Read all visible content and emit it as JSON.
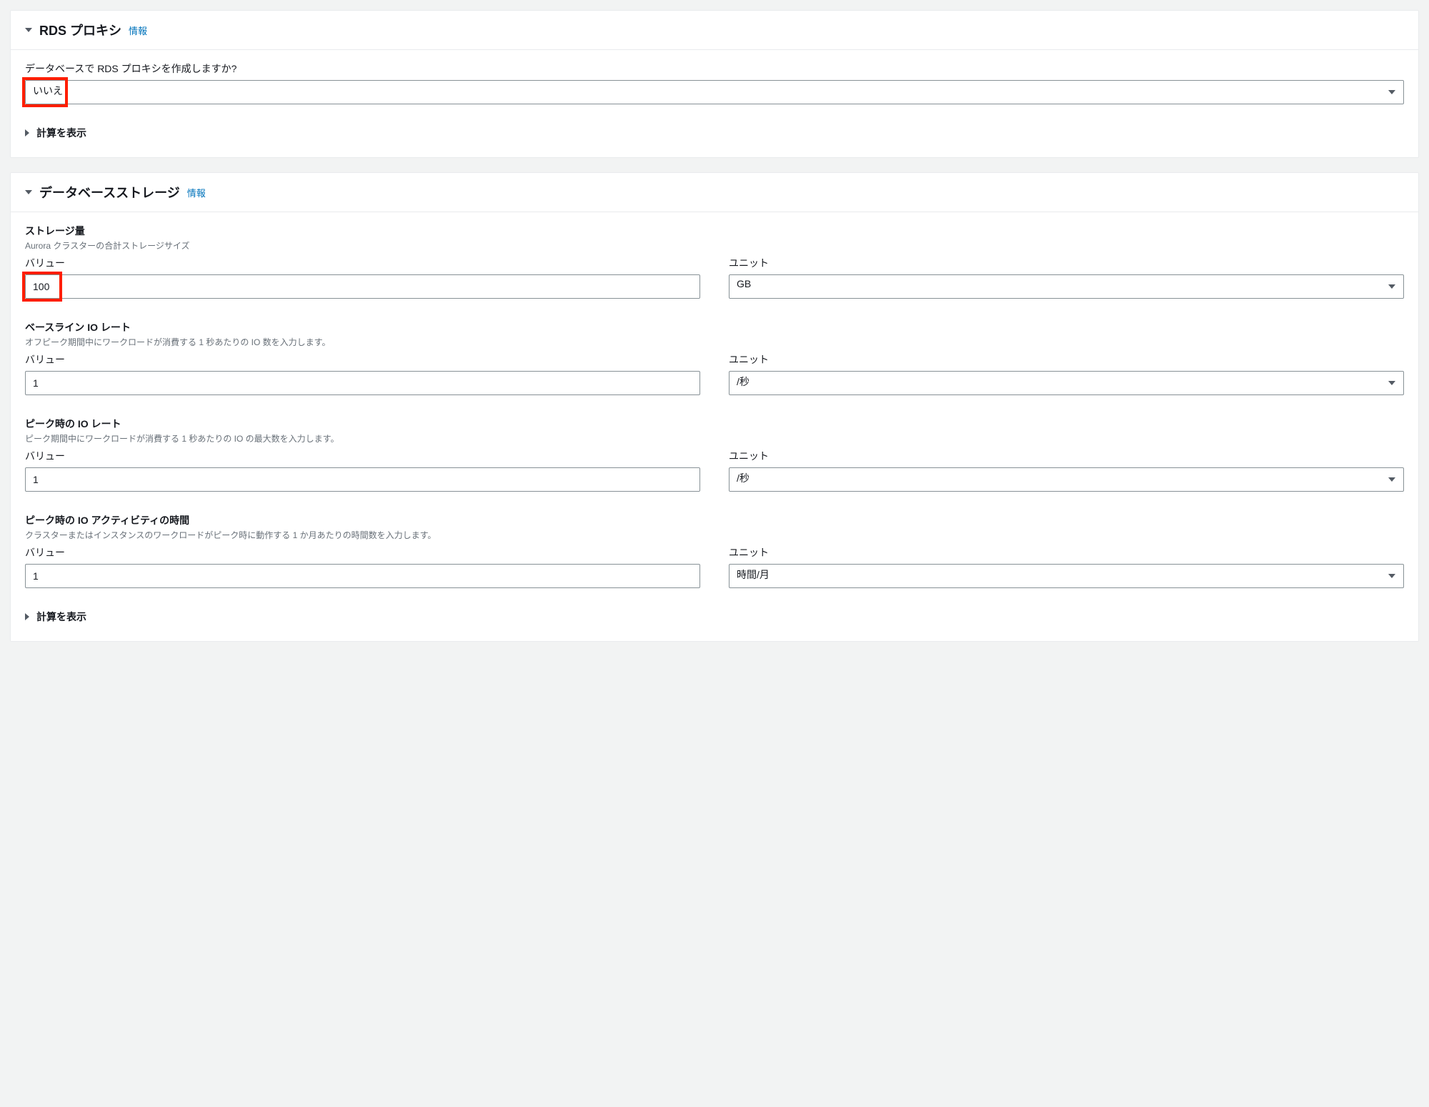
{
  "rds_proxy": {
    "title": "RDS プロキシ",
    "info": "情報",
    "question_label": "データベースで RDS プロキシを作成しますか?",
    "value": "いいえ",
    "show_calc": "計算を表示"
  },
  "db_storage": {
    "title": "データベースストレージ",
    "info": "情報",
    "storage_amount": {
      "heading": "ストレージ量",
      "desc": "Aurora クラスターの合計ストレージサイズ",
      "value_label": "バリュー",
      "value": "100",
      "unit_label": "ユニット",
      "unit": "GB"
    },
    "baseline_io": {
      "heading": "ベースライン IO レート",
      "desc": "オフピーク期間中にワークロードが消費する 1 秒あたりの IO 数を入力します。",
      "value_label": "バリュー",
      "value": "1",
      "unit_label": "ユニット",
      "unit": "/秒"
    },
    "peak_io": {
      "heading": "ピーク時の IO レート",
      "desc": "ピーク期間中にワークロードが消費する 1 秒あたりの IO の最大数を入力します。",
      "value_label": "バリュー",
      "value": "1",
      "unit_label": "ユニット",
      "unit": "/秒"
    },
    "peak_duration": {
      "heading": "ピーク時の IO アクティビティの時間",
      "desc": "クラスターまたはインスタンスのワークロードがピーク時に動作する 1 か月あたりの時間数を入力します。",
      "value_label": "バリュー",
      "value": "1",
      "unit_label": "ユニット",
      "unit": "時間/月"
    },
    "show_calc": "計算を表示"
  }
}
